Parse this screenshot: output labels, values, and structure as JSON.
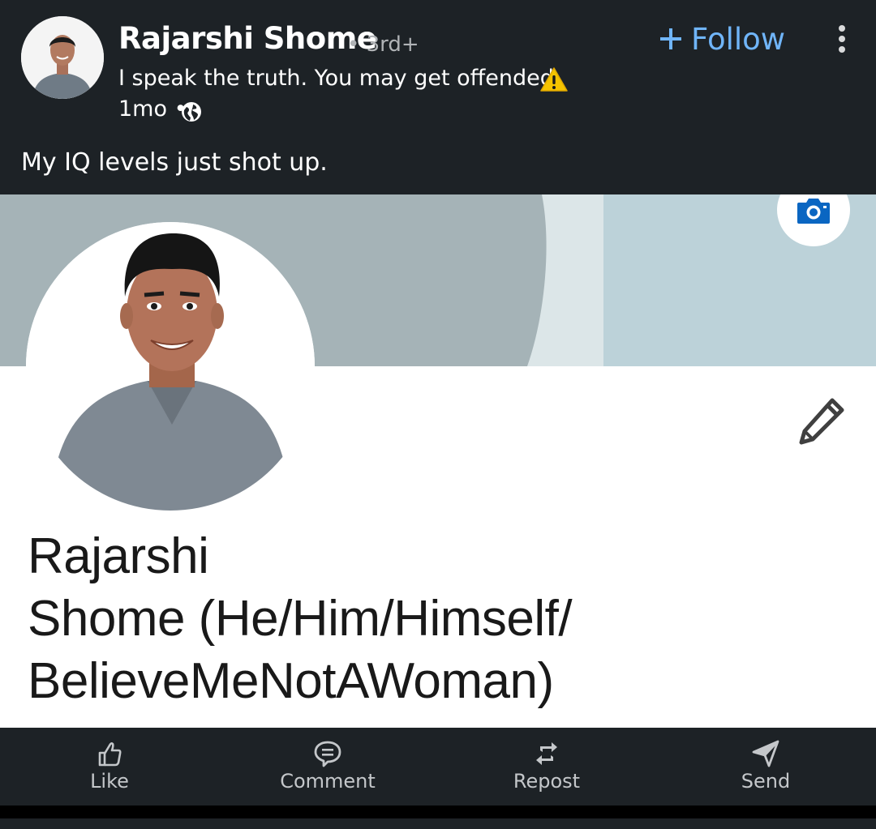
{
  "author": {
    "name": "Rajarshi Shome",
    "degree": "• 3rd+",
    "headline": "I speak the truth. You may get offended",
    "timestamp": "1mo •",
    "visibility_icon": "globe-icon",
    "warning_icon": "warning-icon"
  },
  "actions": {
    "follow_label": "Follow",
    "more_icon": "more-vertical-icon"
  },
  "post": {
    "text": "My IQ levels just shot up."
  },
  "embedded_profile": {
    "name_line1": "Rajarshi",
    "name_line2": "Shome (He/Him/Himself/",
    "name_line3": "BelieveMeNotAWoman)",
    "camera_icon": "camera-icon",
    "edit_icon": "pencil-icon"
  },
  "action_bar": [
    {
      "label": "Like",
      "icon": "like-icon"
    },
    {
      "label": "Comment",
      "icon": "comment-icon"
    },
    {
      "label": "Repost",
      "icon": "repost-icon"
    },
    {
      "label": "Send",
      "icon": "send-icon"
    }
  ],
  "colors": {
    "background": "#1d2226",
    "link": "#70b5f9",
    "text": "#ffffff",
    "muted": "#b0b3b6",
    "banner_dark": "#a5b3b7",
    "banner_light": "#bcd2d9"
  }
}
